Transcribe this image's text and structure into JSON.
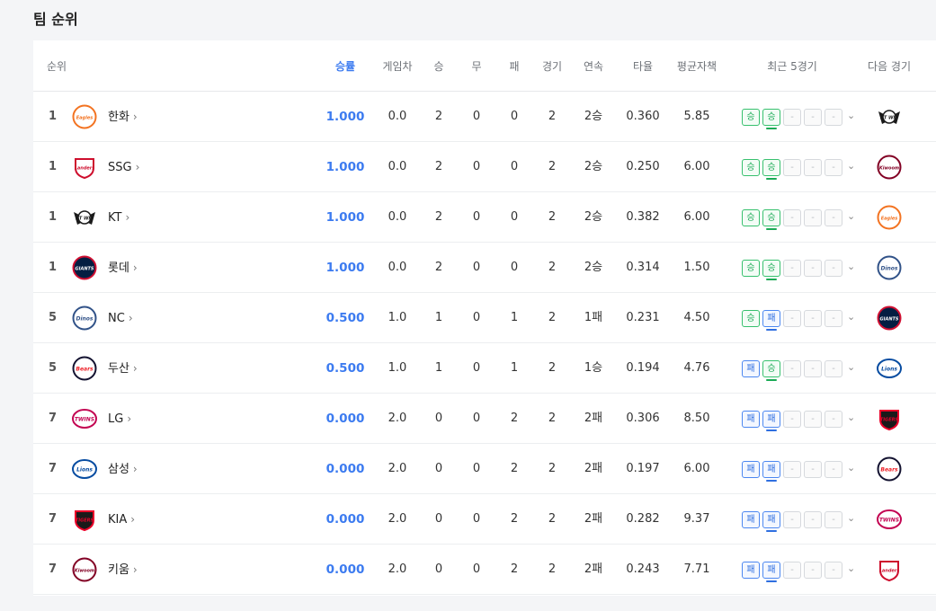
{
  "page_title": "팀 순위",
  "header": {
    "rank": "순위",
    "pct": "승률",
    "gb": "게임차",
    "w": "승",
    "d": "무",
    "l": "패",
    "g": "경기",
    "streak": "연속",
    "avg": "타율",
    "era": "평균자책",
    "recent": "최근 5경기",
    "next": "다음 경기"
  },
  "colors": {
    "accent": "#3c7bf0",
    "win": "#1aaa55",
    "loss": "#2f6fe0"
  },
  "rows": [
    {
      "rank": "1",
      "team": "한화",
      "logo": "eagles-logo",
      "pct": "1.000",
      "gb": "0.0",
      "w": "2",
      "d": "0",
      "l": "0",
      "g": "2",
      "streak": "2승",
      "avg": "0.360",
      "era": "5.85",
      "recent": [
        "승",
        "승",
        "-",
        "-",
        "-"
      ],
      "next": "ktwiz-logo"
    },
    {
      "rank": "1",
      "team": "SSG",
      "logo": "landers-logo",
      "pct": "1.000",
      "gb": "0.0",
      "w": "2",
      "d": "0",
      "l": "0",
      "g": "2",
      "streak": "2승",
      "avg": "0.250",
      "era": "6.00",
      "recent": [
        "승",
        "승",
        "-",
        "-",
        "-"
      ],
      "next": "heroes-logo"
    },
    {
      "rank": "1",
      "team": "KT",
      "logo": "ktwiz-logo",
      "pct": "1.000",
      "gb": "0.0",
      "w": "2",
      "d": "0",
      "l": "0",
      "g": "2",
      "streak": "2승",
      "avg": "0.382",
      "era": "6.00",
      "recent": [
        "승",
        "승",
        "-",
        "-",
        "-"
      ],
      "next": "eagles-logo"
    },
    {
      "rank": "1",
      "team": "롯데",
      "logo": "giants-logo",
      "pct": "1.000",
      "gb": "0.0",
      "w": "2",
      "d": "0",
      "l": "0",
      "g": "2",
      "streak": "2승",
      "avg": "0.314",
      "era": "1.50",
      "recent": [
        "승",
        "승",
        "-",
        "-",
        "-"
      ],
      "next": "dinos-logo"
    },
    {
      "rank": "5",
      "team": "NC",
      "logo": "dinos-logo",
      "pct": "0.500",
      "gb": "1.0",
      "w": "1",
      "d": "0",
      "l": "1",
      "g": "2",
      "streak": "1패",
      "avg": "0.231",
      "era": "4.50",
      "recent": [
        "승",
        "패",
        "-",
        "-",
        "-"
      ],
      "next": "giants-logo"
    },
    {
      "rank": "5",
      "team": "두산",
      "logo": "bears-logo",
      "pct": "0.500",
      "gb": "1.0",
      "w": "1",
      "d": "0",
      "l": "1",
      "g": "2",
      "streak": "1승",
      "avg": "0.194",
      "era": "4.76",
      "recent": [
        "패",
        "승",
        "-",
        "-",
        "-"
      ],
      "next": "lions-logo"
    },
    {
      "rank": "7",
      "team": "LG",
      "logo": "twins-logo",
      "pct": "0.000",
      "gb": "2.0",
      "w": "0",
      "d": "0",
      "l": "2",
      "g": "2",
      "streak": "2패",
      "avg": "0.306",
      "era": "8.50",
      "recent": [
        "패",
        "패",
        "-",
        "-",
        "-"
      ],
      "next": "tigers-logo"
    },
    {
      "rank": "7",
      "team": "삼성",
      "logo": "lions-logo",
      "pct": "0.000",
      "gb": "2.0",
      "w": "0",
      "d": "0",
      "l": "2",
      "g": "2",
      "streak": "2패",
      "avg": "0.197",
      "era": "6.00",
      "recent": [
        "패",
        "패",
        "-",
        "-",
        "-"
      ],
      "next": "bears-logo"
    },
    {
      "rank": "7",
      "team": "KIA",
      "logo": "tigers-logo",
      "pct": "0.000",
      "gb": "2.0",
      "w": "0",
      "d": "0",
      "l": "2",
      "g": "2",
      "streak": "2패",
      "avg": "0.282",
      "era": "9.37",
      "recent": [
        "패",
        "패",
        "-",
        "-",
        "-"
      ],
      "next": "twins-logo"
    },
    {
      "rank": "7",
      "team": "키움",
      "logo": "heroes-logo",
      "pct": "0.000",
      "gb": "2.0",
      "w": "0",
      "d": "0",
      "l": "2",
      "g": "2",
      "streak": "2패",
      "avg": "0.243",
      "era": "7.71",
      "recent": [
        "패",
        "패",
        "-",
        "-",
        "-"
      ],
      "next": "landers-logo"
    }
  ]
}
